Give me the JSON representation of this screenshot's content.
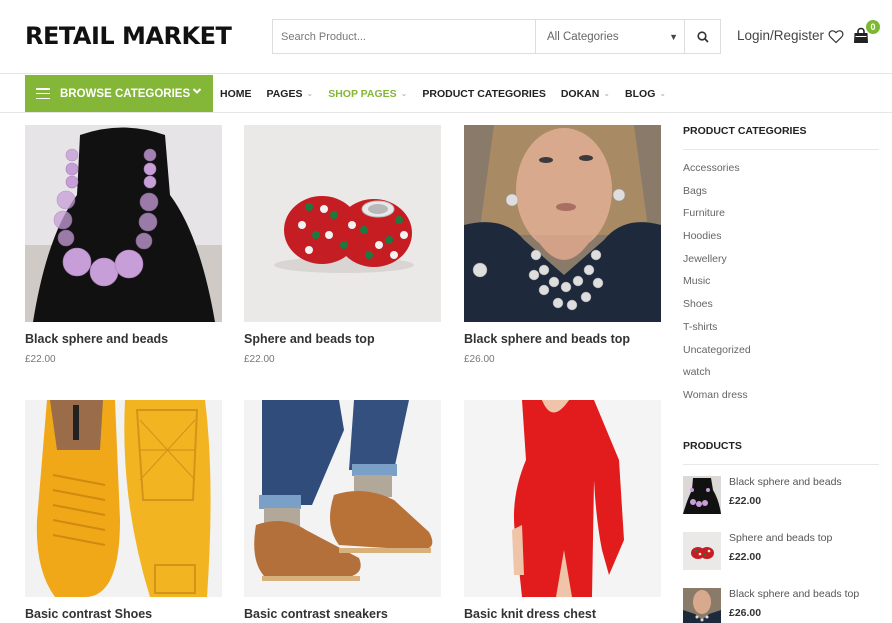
{
  "header": {
    "logo": "RETAIL MARKET",
    "search_placeholder": "Search Product...",
    "category_select": "All Categories",
    "login_label": "Login/Register",
    "cart_count": "0"
  },
  "nav": {
    "browse_label": "BROWSE CATEGORIES",
    "items": [
      {
        "label": "HOME",
        "dropdown": false,
        "active": false
      },
      {
        "label": "PAGES",
        "dropdown": true,
        "active": false
      },
      {
        "label": "SHOP PAGES",
        "dropdown": true,
        "active": true
      },
      {
        "label": "PRODUCT CATEGORIES",
        "dropdown": false,
        "active": false
      },
      {
        "label": "DOKAN",
        "dropdown": true,
        "active": false
      },
      {
        "label": "BLOG",
        "dropdown": true,
        "active": false
      }
    ]
  },
  "products": [
    {
      "name": "Black sphere and beads",
      "price": "£22.00",
      "image": "purple-bead-necklace"
    },
    {
      "name": "Sphere and beads top",
      "price": "£22.00",
      "image": "red-green-charm-beads"
    },
    {
      "name": "Black sphere and beads top",
      "price": "£26.00",
      "image": "woman-pearl-necklace"
    },
    {
      "name": "Basic contrast Shoes",
      "price": "",
      "image": "yellow-sneakers"
    },
    {
      "name": "Basic contrast sneakers",
      "price": "",
      "image": "suede-desert-boots"
    },
    {
      "name": "Basic knit dress chest",
      "price": "",
      "image": "red-dress"
    }
  ],
  "sidebar": {
    "categories_title": "PRODUCT CATEGORIES",
    "categories": [
      "Accessories",
      "Bags",
      "Furniture",
      "Hoodies",
      "Jewellery",
      "Music",
      "Shoes",
      "T-shirts",
      "Uncategorized",
      "watch",
      "Woman dress"
    ],
    "products_title": "PRODUCTS",
    "products": [
      {
        "name": "Black sphere and beads",
        "price": "£22.00"
      },
      {
        "name": "Sphere and beads top",
        "price": "£22.00"
      },
      {
        "name": "Black sphere and beads top",
        "price": "£26.00"
      }
    ]
  },
  "colors": {
    "accent": "#84b637",
    "badge": "#7db833"
  }
}
